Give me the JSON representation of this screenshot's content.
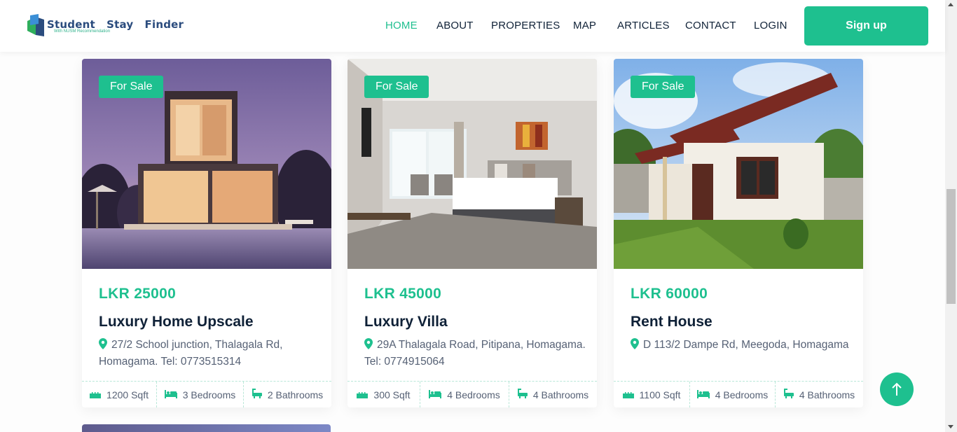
{
  "header": {
    "logo_text": "Student   Stay   Finder",
    "logo_sub": "With NUSM Recommendation",
    "nav": [
      "HOME",
      "ABOUT",
      "PROPERTIES",
      "MAP",
      "ARTICLES",
      "CONTACT",
      "LOGIN"
    ],
    "active_nav": "HOME",
    "signup_label": "Sign up"
  },
  "colors": {
    "accent": "#1ec08f",
    "text": "#0f2137",
    "muted": "#566175"
  },
  "listings": [
    {
      "badge": "For Sale",
      "price": "LKR 25000",
      "title": "Luxury Home Upscale",
      "address": "27/2 School junction, Thalagala Rd, Homagama. Tel: 0773515314",
      "sqft": "1200 Sqft",
      "bedrooms": "3 Bedrooms",
      "bathrooms": "2 Bathrooms",
      "image": "modern-house-pool-dusk"
    },
    {
      "badge": "For Sale",
      "price": "LKR 45000",
      "title": "Luxury Villa",
      "address": "29A Thalagala Road, Pitipana, Homagama. Tel: 0774915064",
      "sqft": "300 Sqft",
      "bedrooms": "4 Bedrooms",
      "bathrooms": "4 Bathrooms",
      "image": "hotel-bedroom"
    },
    {
      "badge": "For Sale",
      "price": "LKR 60000",
      "title": "Rent House",
      "address": "D 113/2 Dampe Rd, Meegoda, Homagama",
      "sqft": "1100 Sqft",
      "bedrooms": "4 Bedrooms",
      "bathrooms": "4 Bathrooms",
      "image": "single-storey-house-garden"
    }
  ],
  "icons": {
    "scroll_top": "arrow-up-icon",
    "location": "map-pin-icon",
    "area": "ruler-icon",
    "bed": "bed-icon",
    "bath": "bathtub-icon"
  }
}
